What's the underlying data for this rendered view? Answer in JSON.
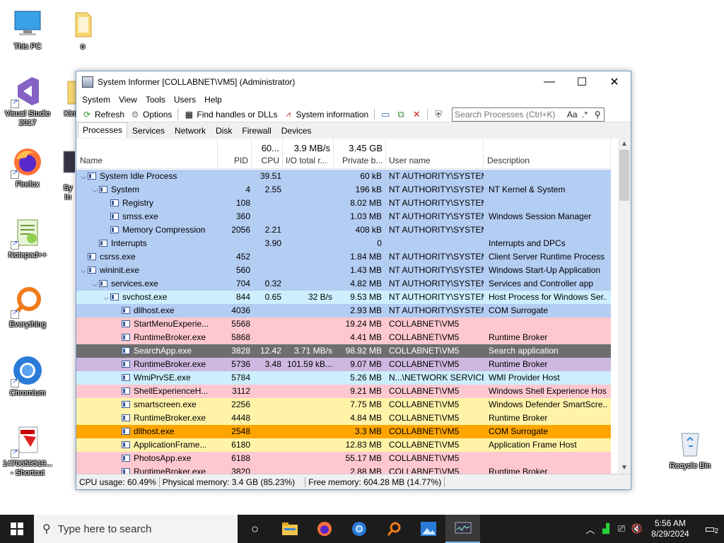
{
  "desktop": {
    "icons": [
      {
        "label": "This PC",
        "icon": "computer-icon"
      },
      {
        "label": "o",
        "icon": "folder-icon"
      },
      {
        "label": "Visual Studio 2017",
        "icon": "visual-studio-icon"
      },
      {
        "label": "Kinit",
        "icon": "folder-icon"
      },
      {
        "label": "Firefox",
        "icon": "firefox-icon"
      },
      {
        "label": "Sy In",
        "icon": "system-informer-icon"
      },
      {
        "label": "Notepad++",
        "icon": "notepad-plus-plus-icon"
      },
      {
        "label": "Everything",
        "icon": "everything-search-icon"
      },
      {
        "label": "Chromium",
        "icon": "chromium-icon"
      },
      {
        "label": "1470659519... - Shortcut",
        "icon": "shortcut-file-icon"
      },
      {
        "label": "Recycle Bin",
        "icon": "recycle-bin-icon"
      }
    ]
  },
  "window": {
    "title": "System Informer [COLLABNET\\VM5] (Administrator)",
    "minimize": "—",
    "maximize": "☐",
    "close": "✕",
    "menu": [
      "System",
      "View",
      "Tools",
      "Users",
      "Help"
    ],
    "toolbar": {
      "refresh": "Refresh",
      "options": "Options",
      "find_handles": "Find handles or DLLs",
      "system_information": "System information",
      "search_placeholder": "Search Processes (Ctrl+K)",
      "search_case": "Aa",
      "search_regex": ".*"
    },
    "tabs": [
      "Processes",
      "Services",
      "Network",
      "Disk",
      "Firewall",
      "Devices"
    ],
    "columns": {
      "name": "Name",
      "pid": "PID",
      "cpu": "CPU",
      "cpu_sum": "60...",
      "io": "I/O total r...",
      "io_sum": "3.9 MB/s",
      "priv": "Private b...",
      "priv_sum": "3.45 GB",
      "user": "User name",
      "desc": "Description"
    },
    "colors": {
      "system": "#b4cdf3",
      "service": "#cceeff",
      "user": "#ffc8d0",
      "selected": "#6e6e6e",
      "suspended": "#cfb8e0",
      "elevated": "#fff3a8",
      "highlight": "#ffa500"
    },
    "processes": [
      {
        "name": "System Idle Process",
        "depth": 0,
        "arrow": "v",
        "pid": "",
        "cpu": "39.51",
        "io": "",
        "priv": "60 kB",
        "user": "NT AUTHORITY\\SYSTEM",
        "desc": "",
        "color": "system"
      },
      {
        "name": "System",
        "depth": 1,
        "arrow": "v",
        "pid": "4",
        "cpu": "2.55",
        "io": "",
        "priv": "196 kB",
        "user": "NT AUTHORITY\\SYSTEM",
        "desc": "NT Kernel & System",
        "color": "system"
      },
      {
        "name": "Registry",
        "depth": 2,
        "arrow": "",
        "pid": "108",
        "cpu": "",
        "io": "",
        "priv": "8.02 MB",
        "user": "NT AUTHORITY\\SYSTEM",
        "desc": "",
        "color": "system"
      },
      {
        "name": "smss.exe",
        "depth": 2,
        "arrow": "",
        "pid": "360",
        "cpu": "",
        "io": "",
        "priv": "1.03 MB",
        "user": "NT AUTHORITY\\SYSTEM",
        "desc": "Windows Session Manager",
        "color": "system"
      },
      {
        "name": "Memory Compression",
        "depth": 2,
        "arrow": "",
        "pid": "2056",
        "cpu": "2.21",
        "io": "",
        "priv": "408 kB",
        "user": "NT AUTHORITY\\SYSTEM",
        "desc": "",
        "color": "system"
      },
      {
        "name": "Interrupts",
        "depth": 1,
        "arrow": "",
        "pid": "",
        "cpu": "3.90",
        "io": "",
        "priv": "0",
        "user": "",
        "desc": "Interrupts and DPCs",
        "color": "system"
      },
      {
        "name": "csrss.exe",
        "depth": 0,
        "arrow": "",
        "pid": "452",
        "cpu": "",
        "io": "",
        "priv": "1.84 MB",
        "user": "NT AUTHORITY\\SYSTEM",
        "desc": "Client Server Runtime Process",
        "color": "system"
      },
      {
        "name": "wininit.exe",
        "depth": 0,
        "arrow": "v",
        "pid": "560",
        "cpu": "",
        "io": "",
        "priv": "1.43 MB",
        "user": "NT AUTHORITY\\SYSTEM",
        "desc": "Windows Start-Up Application",
        "color": "system"
      },
      {
        "name": "services.exe",
        "depth": 1,
        "arrow": "v",
        "pid": "704",
        "cpu": "0.32",
        "io": "",
        "priv": "4.82 MB",
        "user": "NT AUTHORITY\\SYSTEM",
        "desc": "Services and Controller app",
        "color": "system"
      },
      {
        "name": "svchost.exe",
        "depth": 2,
        "arrow": "v",
        "pid": "844",
        "cpu": "0.65",
        "io": "32 B/s",
        "priv": "9.53 MB",
        "user": "NT AUTHORITY\\SYSTEM",
        "desc": "Host Process for Windows Ser...",
        "color": "service"
      },
      {
        "name": "dllhost.exe",
        "depth": 3,
        "arrow": "",
        "pid": "4036",
        "cpu": "",
        "io": "",
        "priv": "2.93 MB",
        "user": "NT AUTHORITY\\SYSTEM",
        "desc": "COM Surrogate",
        "color": "system"
      },
      {
        "name": "StartMenuExperie...",
        "depth": 3,
        "arrow": "",
        "pid": "5568",
        "cpu": "",
        "io": "",
        "priv": "19.24 MB",
        "user": "COLLABNET\\VM5",
        "desc": "",
        "color": "user"
      },
      {
        "name": "RuntimeBroker.exe",
        "depth": 3,
        "arrow": "",
        "pid": "5868",
        "cpu": "",
        "io": "",
        "priv": "4.41 MB",
        "user": "COLLABNET\\VM5",
        "desc": "Runtime Broker",
        "color": "user"
      },
      {
        "name": "SearchApp.exe",
        "depth": 3,
        "arrow": "",
        "pid": "3828",
        "cpu": "12.42",
        "io": "3.71 MB/s",
        "priv": "98.92 MB",
        "user": "COLLABNET\\VM5",
        "desc": "Search application",
        "color": "selected"
      },
      {
        "name": "RuntimeBroker.exe",
        "depth": 3,
        "arrow": "",
        "pid": "5736",
        "cpu": "3.48",
        "io": "101.59 kB...",
        "priv": "9.07 MB",
        "user": "COLLABNET\\VM5",
        "desc": "Runtime Broker",
        "color": "suspended"
      },
      {
        "name": "WmiPrvSE.exe",
        "depth": 3,
        "arrow": "",
        "pid": "5784",
        "cpu": "",
        "io": "",
        "priv": "5.26 MB",
        "user": "N...\\NETWORK SERVICE",
        "desc": "WMI Provider Host",
        "color": "service"
      },
      {
        "name": "ShellExperienceH...",
        "depth": 3,
        "arrow": "",
        "pid": "3112",
        "cpu": "",
        "io": "",
        "priv": "9.21 MB",
        "user": "COLLABNET\\VM5",
        "desc": "Windows Shell Experience Host",
        "color": "user"
      },
      {
        "name": "smartscreen.exe",
        "depth": 3,
        "arrow": "",
        "pid": "2256",
        "cpu": "",
        "io": "",
        "priv": "7.75 MB",
        "user": "COLLABNET\\VM5",
        "desc": "Windows Defender SmartScre...",
        "color": "elevated"
      },
      {
        "name": "RuntimeBroker.exe",
        "depth": 3,
        "arrow": "",
        "pid": "4448",
        "cpu": "",
        "io": "",
        "priv": "4.84 MB",
        "user": "COLLABNET\\VM5",
        "desc": "Runtime Broker",
        "color": "elevated"
      },
      {
        "name": "dllhost.exe",
        "depth": 3,
        "arrow": "",
        "pid": "2548",
        "cpu": "",
        "io": "",
        "priv": "3.3 MB",
        "user": "COLLABNET\\VM5",
        "desc": "COM Surrogate",
        "color": "highlight"
      },
      {
        "name": "ApplicationFrame...",
        "depth": 3,
        "arrow": "",
        "pid": "6180",
        "cpu": "",
        "io": "",
        "priv": "12.83 MB",
        "user": "COLLABNET\\VM5",
        "desc": "Application Frame Host",
        "color": "elevated"
      },
      {
        "name": "PhotosApp.exe",
        "depth": 3,
        "arrow": "",
        "pid": "6188",
        "cpu": "",
        "io": "",
        "priv": "55.17 MB",
        "user": "COLLABNET\\VM5",
        "desc": "",
        "color": "user"
      },
      {
        "name": "RuntimeBroker.exe",
        "depth": 3,
        "arrow": "",
        "pid": "3820",
        "cpu": "",
        "io": "",
        "priv": "2.88 MB",
        "user": "COLLABNET\\VM5",
        "desc": "Runtime Broker",
        "color": "user"
      }
    ],
    "status": {
      "cpu": "CPU usage: 60.49%",
      "physical": "Physical memory: 3.4 GB (85.23%)",
      "free": "Free memory: 604.28 MB (14.77%)"
    }
  },
  "taskbar": {
    "search_placeholder": "Type here to search",
    "apps": [
      "task-view-icon",
      "file-explorer-icon",
      "firefox-icon",
      "chromium-icon",
      "everything-search-icon",
      "photos-icon",
      "system-informer-icon"
    ],
    "time": "5:56 AM",
    "date": "8/29/2024",
    "notification_count": "2"
  }
}
